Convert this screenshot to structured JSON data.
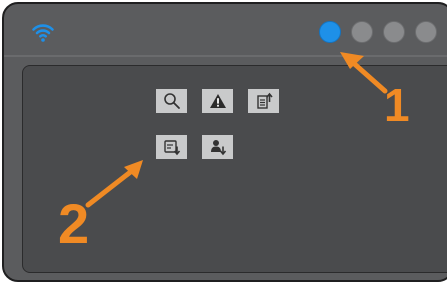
{
  "window": {
    "status_dots": [
      {
        "state": "active"
      },
      {
        "state": "inactive"
      },
      {
        "state": "inactive"
      },
      {
        "state": "inactive"
      }
    ]
  },
  "toolbar_icons": [
    {
      "icon": "search-icon"
    },
    {
      "icon": "warning-icon"
    },
    {
      "icon": "document-upload-icon"
    },
    {
      "icon": "document-download-icon"
    },
    {
      "icon": "user-download-icon"
    }
  ],
  "callouts": {
    "one": "1",
    "two": "2"
  },
  "colors": {
    "frame": "#5b5c5e",
    "screen": "#4a4b4d",
    "active_dot": "#1e90e8",
    "inactive_dot": "#8a8b8d",
    "icon_button": "#c9cacb",
    "callout": "#f08a24",
    "wifi": "#1e90e8"
  }
}
